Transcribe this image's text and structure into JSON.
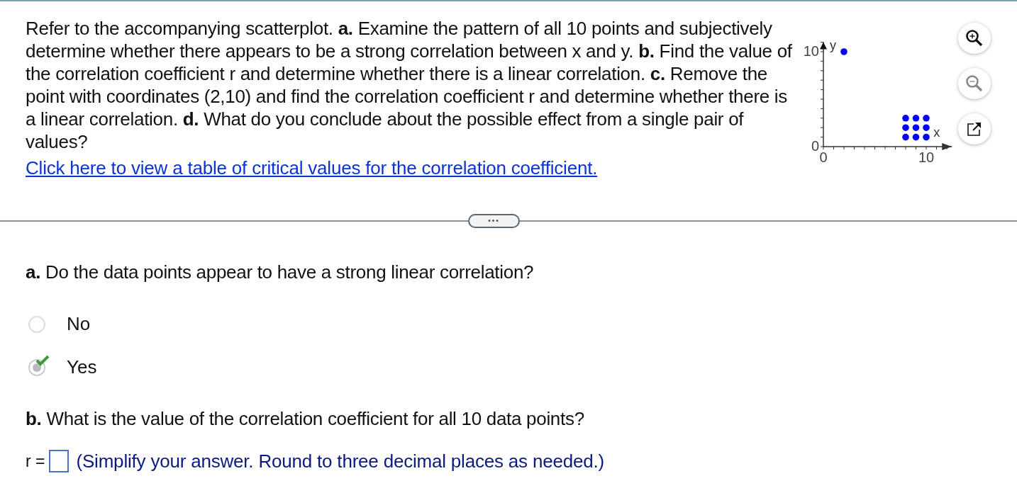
{
  "question": {
    "text": "Refer to the accompanying scatterplot. **a.** Examine the pattern of all 10 points and subjectively determine whether there appears to be a strong correlation between x and y. **b.** Find the value of the correlation coefficient r and determine whether there is a linear correlation. **c.** Remove the point with coordinates (2,10) and find the correlation coefficient r and determine whether there is a linear correlation. **d.** What do you conclude about the possible effect from a single pair of values?",
    "link": "Click here to view a table of critical values for the correlation coefficient.",
    "chart_data": {
      "type": "scatter",
      "xlabel": "x",
      "ylabel": "y",
      "x": [
        2,
        8,
        9,
        10,
        8,
        9,
        10,
        8,
        9,
        10
      ],
      "series": [
        {
          "color": "#0000ff",
          "values": [
            10,
            1,
            1,
            1,
            2,
            2,
            2,
            3,
            3,
            3
          ]
        }
      ],
      "xlim": [
        0,
        12.5
      ],
      "ylim": [
        0,
        11
      ],
      "xticks": [
        0,
        10
      ],
      "yticks": [
        0,
        10
      ]
    }
  },
  "part_a": {
    "prompt": "**a.** Do the data points appear to have a strong linear correlation?",
    "options": [
      {
        "label": "No",
        "selected": false,
        "correct": false
      },
      {
        "label": "Yes",
        "selected": true,
        "correct": true
      }
    ]
  },
  "part_b": {
    "prompt": "**b.** What is the value of the correlation coefficient for all 10 data points?",
    "answer_label": "r =",
    "hint": "(Simplify your answer. Round to three decimal places as needed.)"
  },
  "more_button": "•••"
}
